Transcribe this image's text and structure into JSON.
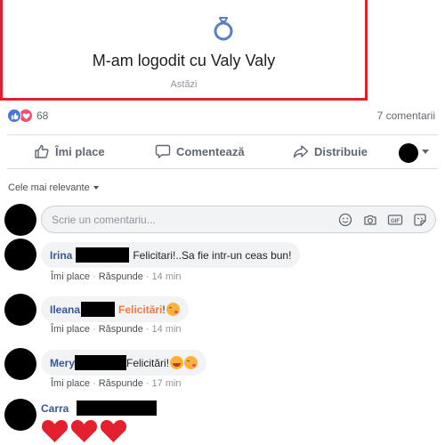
{
  "life_event": {
    "icon": "ring-icon",
    "title": "M-am logodit cu Valy Valy",
    "date": "Astăzi",
    "border_color": "#e0202b"
  },
  "reactions": {
    "count": "68",
    "types": [
      "like",
      "love"
    ],
    "comments_label": "7 comentarii"
  },
  "actions": {
    "like": "Îmi place",
    "comment": "Comentează",
    "share": "Distribuie"
  },
  "comments_filter": "Cele mai relevante",
  "composer": {
    "placeholder": "Scrie un comentariu...",
    "tools": [
      "emoji-icon",
      "camera-icon",
      "gif-icon",
      "sticker-icon"
    ]
  },
  "comments": [
    {
      "author": "Irina",
      "text": "Felicitari!..Sa fie intr-un ceas bun!",
      "like": "Îmi place",
      "reply": "Răspunde",
      "time": "14 min"
    },
    {
      "author": "Ileana",
      "text": "Felicitări",
      "suffix": "!",
      "like": "Îmi place",
      "reply": "Răspunde",
      "time": "14 min"
    },
    {
      "author": "Mery",
      "text": " Felicitări!",
      "like": "Îmi place",
      "reply": "Răspunde",
      "time": "17 min"
    },
    {
      "author": "Carra"
    }
  ],
  "colors": {
    "link": "#385898",
    "like_blue": "#4a76d9",
    "love_red": "#f0506e",
    "orange_text": "#ee7a48"
  }
}
